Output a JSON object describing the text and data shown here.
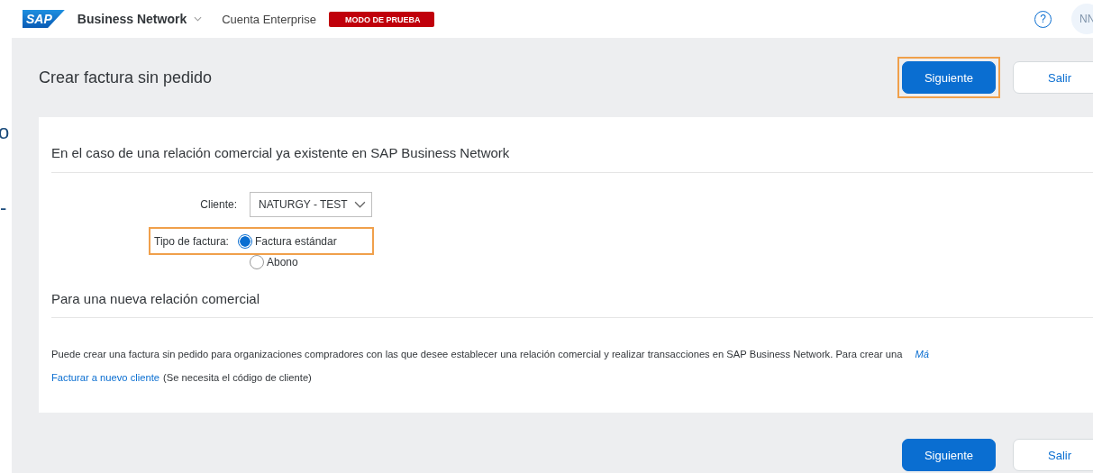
{
  "header": {
    "logo": "SAP",
    "product": "Business Network",
    "account": "Cuenta Enterprise",
    "badge": "MODO DE PRUEBA",
    "help": "?",
    "avatar": "NN"
  },
  "side_fragments": [
    "o",
    "-"
  ],
  "page": {
    "title": "Crear factura sin pedido",
    "buttons": [
      {
        "label": "Siguiente",
        "kind": "primary",
        "highlighted": true
      },
      {
        "label": "Salir",
        "kind": "secondary",
        "highlighted": false
      }
    ]
  },
  "existing": {
    "heading": "En el caso de una relación comercial ya existente en SAP Business Network",
    "client_label": "Cliente:",
    "client_value": "NATURGY - TEST",
    "type_label": "Tipo de factura:",
    "type_highlighted": true,
    "options": [
      {
        "label": "Factura estándar",
        "selected": true
      },
      {
        "label": "Abono",
        "selected": false
      }
    ]
  },
  "new_relation": {
    "heading": "Para una nueva relación comercial",
    "text": "Puede crear una factura sin pedido para organizaciones compradores con las que desee establecer una relación comercial y realizar transacciones en SAP Business Network. Para crear una",
    "more_link": "Má",
    "link": "Facturar a nuevo cliente",
    "link_note": "(Se necesita el código de cliente)"
  },
  "footer_buttons": [
    {
      "label": "Siguiente",
      "kind": "primary",
      "highlighted": false
    },
    {
      "label": "Salir",
      "kind": "secondary",
      "highlighted": false
    }
  ]
}
